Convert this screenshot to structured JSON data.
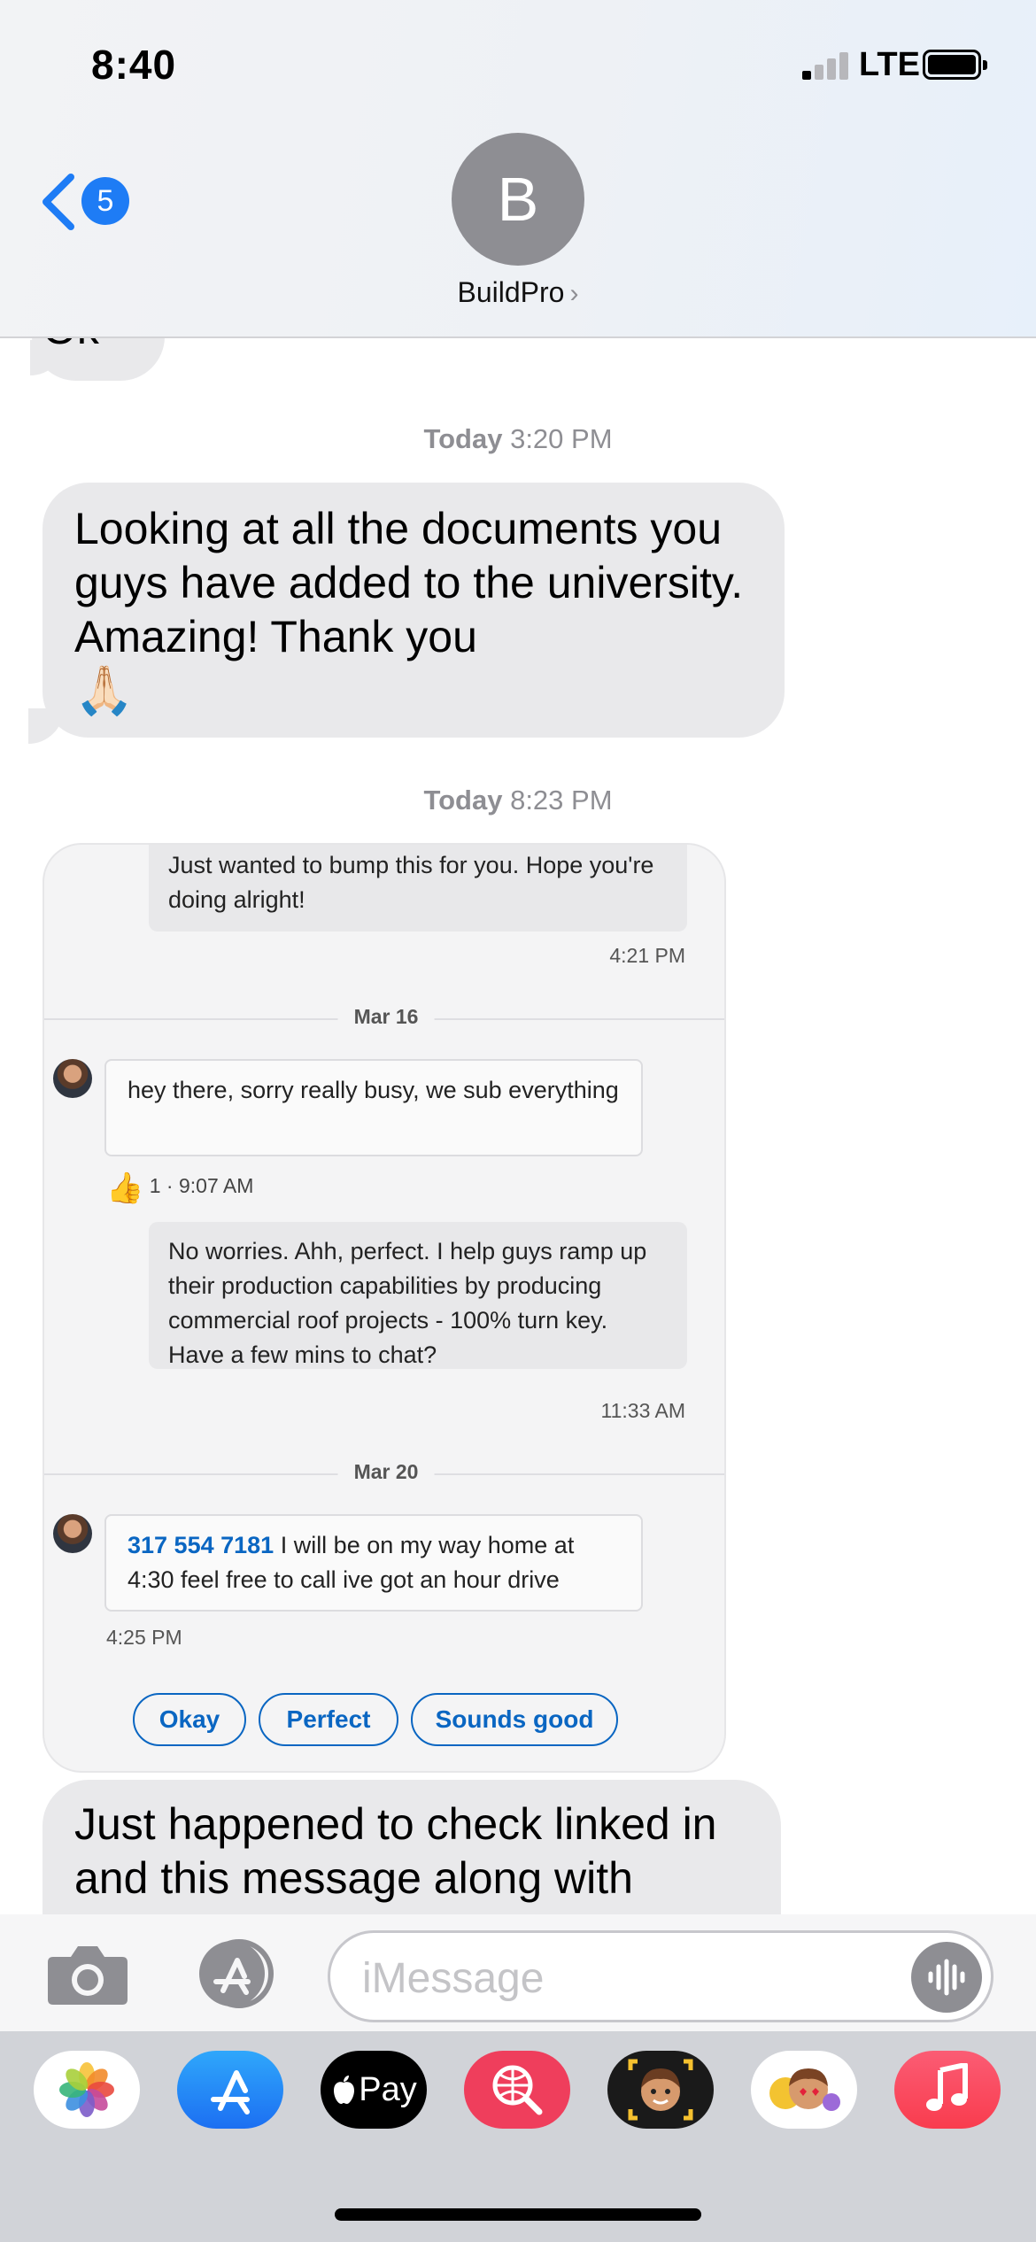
{
  "status_bar": {
    "time": "8:40",
    "network": "LTE"
  },
  "header": {
    "back_count": "5",
    "avatar_initial": "B",
    "contact_name": "BuildPro"
  },
  "conversation": {
    "partial_top_text": "Ok",
    "timestamp1": {
      "day": "Today",
      "time": "3:20 PM"
    },
    "message1": "Looking at all the documents you guys have added to the university. Amazing! Thank you",
    "message1_emoji": "🙏🏻",
    "timestamp2": {
      "day": "Today",
      "time": "8:23 PM"
    },
    "message2": "Just happened to check linked in and this message along with"
  },
  "linkedin_screenshot": {
    "sent1": "Just wanted to bump this for you. Hope you're doing alright!",
    "sent1_time": "4:21 PM",
    "divider1": "Mar 16",
    "recv1": "hey there, sorry really busy, we sub everything",
    "recv1_reaction_count": "1",
    "recv1_time": "9:07 AM",
    "sent2": "No worries. Ahh, perfect. I help guys ramp up their production capabilities by producing commercial roof projects - 100% turn key. Have a few mins to chat?",
    "sent2_time": "11:33 AM",
    "divider2": "Mar 20",
    "recv2_phone": "317 554 7181",
    "recv2_text": "I will be on my way home at 4:30 feel free to call ive got an hour drive",
    "recv2_time": "4:25 PM",
    "quick_replies": [
      "Okay",
      "Perfect",
      "Sounds good"
    ]
  },
  "input": {
    "placeholder": "iMessage"
  },
  "app_tray": {
    "apple_pay_label": "Pay"
  },
  "colors": {
    "ios_blue": "#1e7cf5",
    "bubble_gray": "#e9e9eb",
    "linkedin_blue": "#0a66c2"
  }
}
